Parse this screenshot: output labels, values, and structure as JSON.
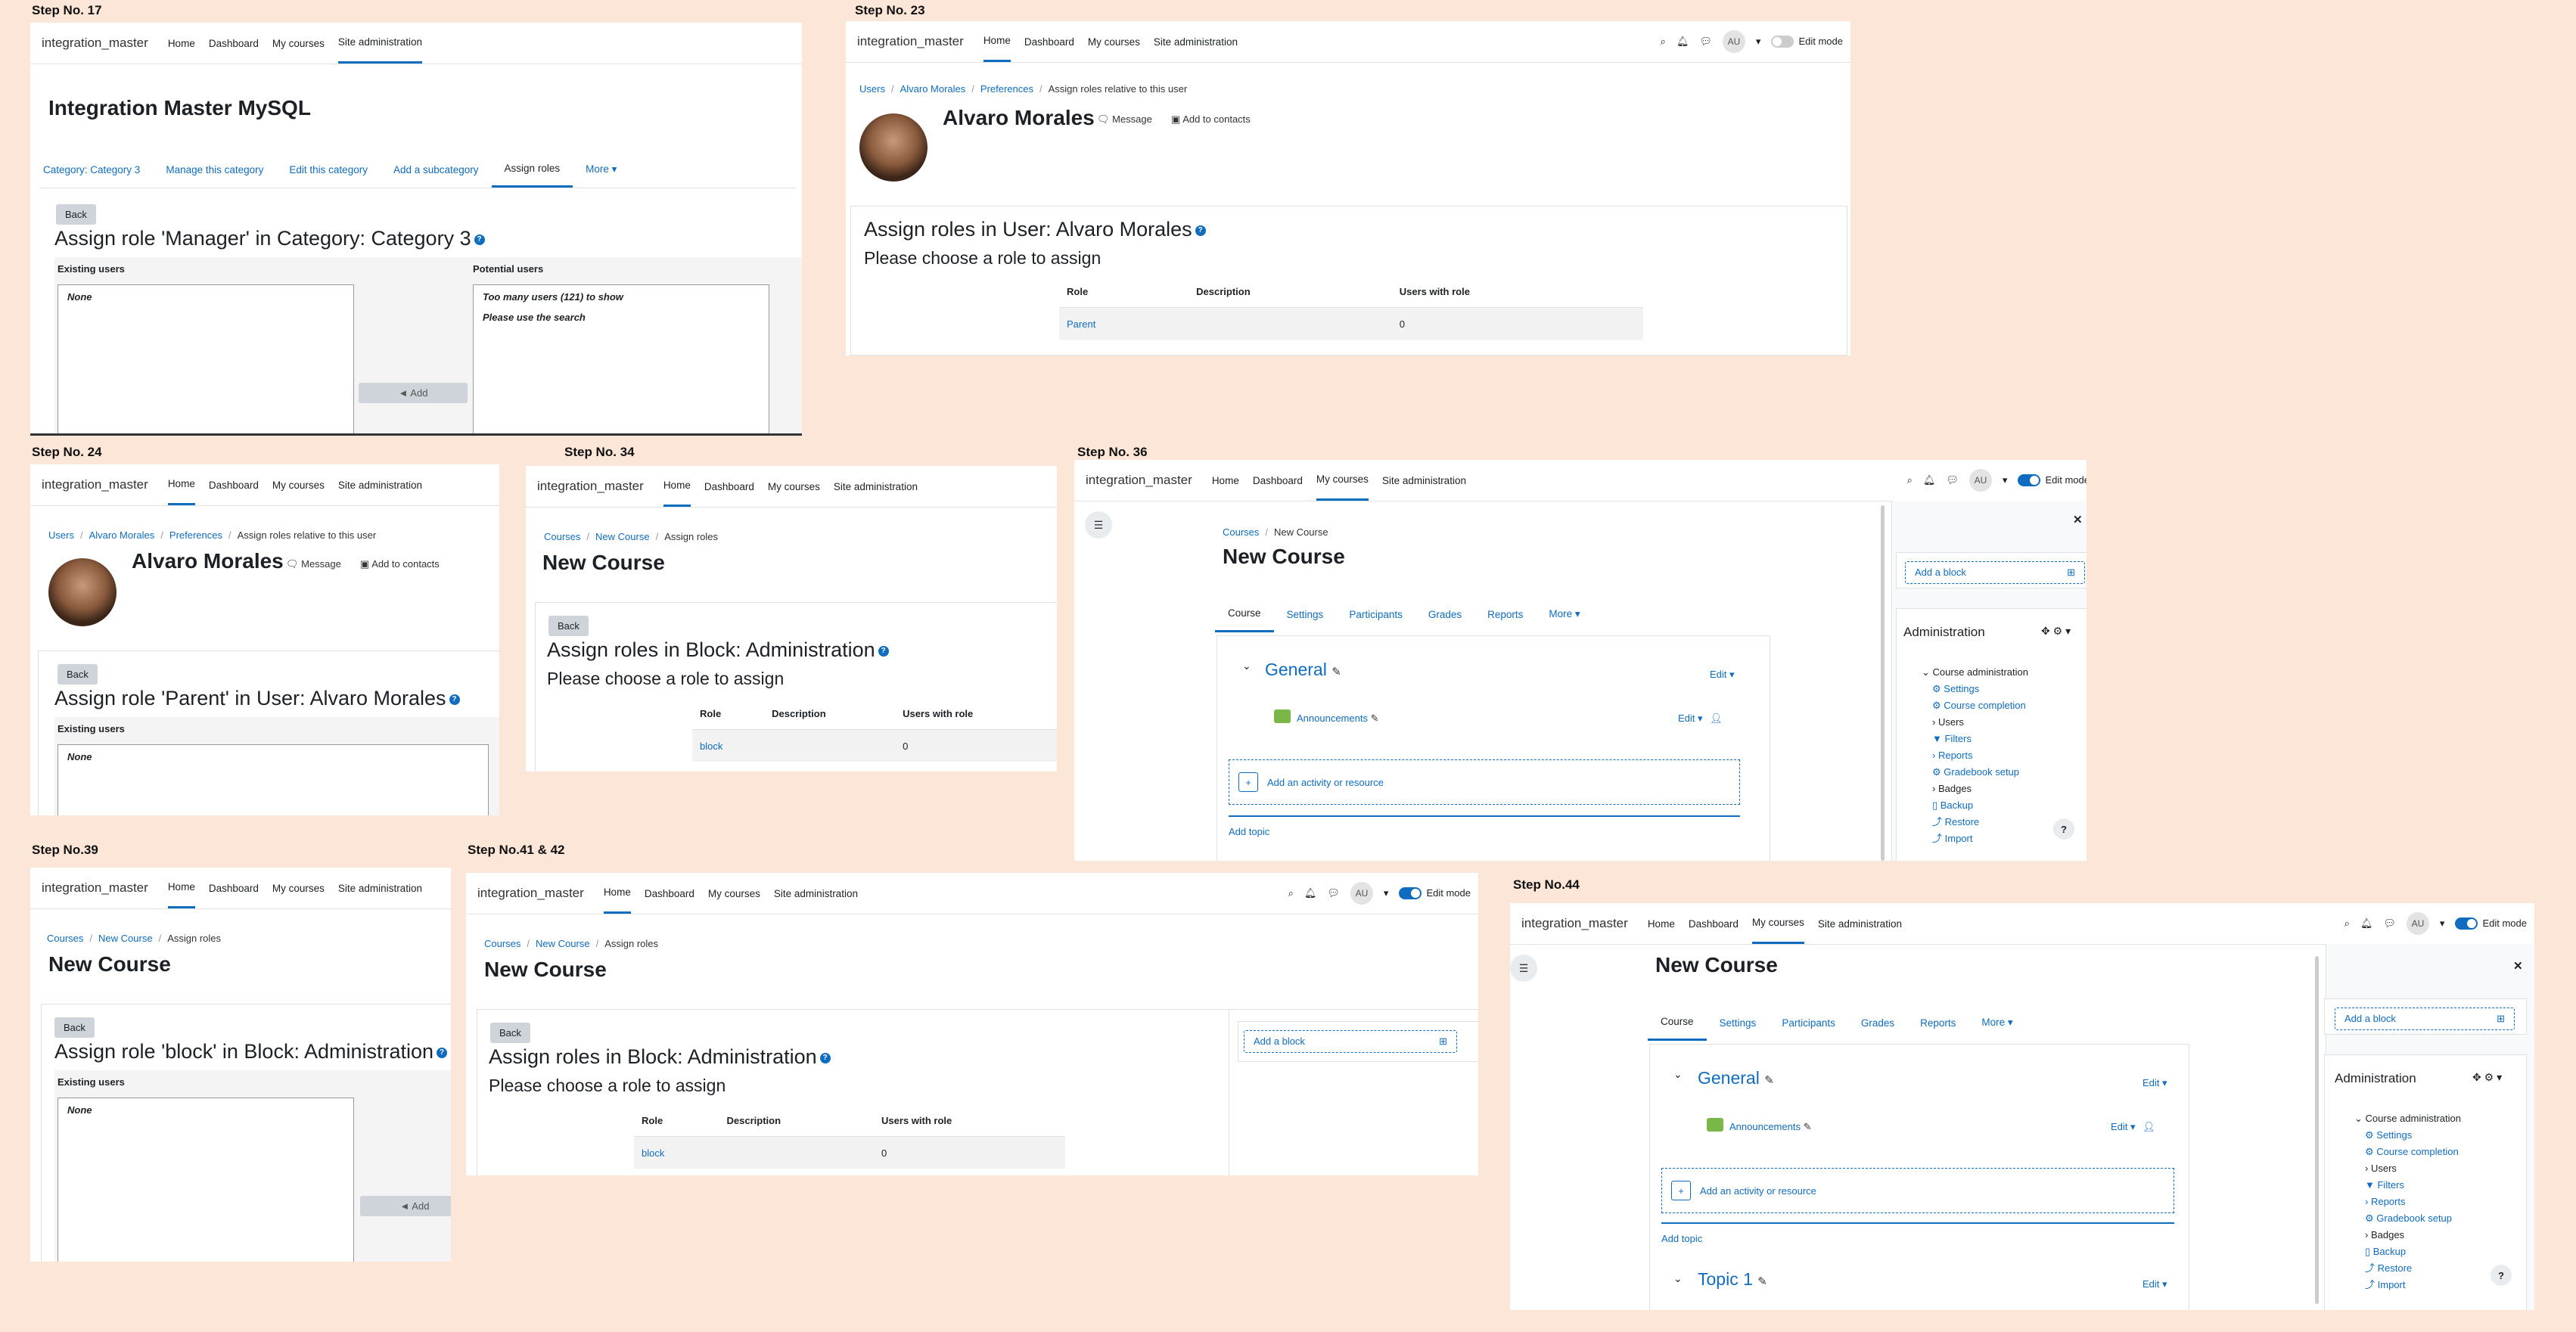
{
  "brand": "integration_master",
  "nav": {
    "home": "Home",
    "dashboard": "Dashboard",
    "mycourses": "My courses",
    "siteadmin": "Site administration"
  },
  "common": {
    "back": "Back",
    "add": "◄ Add",
    "edit_mode": "Edit mode",
    "avatar_initials": "AU",
    "existing_users": "Existing users",
    "potential_users": "Potential users",
    "none": "None",
    "choose_role": "Please choose a role to assign",
    "col_role": "Role",
    "col_desc": "Description",
    "col_users": "Users with role",
    "message": "Message",
    "add_contacts": "Add to contacts",
    "add_block": "Add a block",
    "edit": "Edit",
    "qmark": "?"
  },
  "step17": {
    "label": "Step No. 17",
    "title": "Integration Master MySQL",
    "tabs": [
      "Category: Category 3",
      "Manage this category",
      "Edit this category",
      "Add a subcategory",
      "Assign roles",
      "More ▾"
    ],
    "heading": "Assign role 'Manager' in Category: Category 3",
    "potential": [
      "Too many users (121) to show",
      "Please use the search"
    ]
  },
  "step23": {
    "label": "Step No. 23",
    "crumbs": [
      "Users",
      "Alvaro Morales",
      "Preferences",
      "Assign roles relative to this user"
    ],
    "name": "Alvaro Morales",
    "heading": "Assign roles in User: Alvaro Morales",
    "row": {
      "role": "Parent",
      "desc": "",
      "count": "0"
    }
  },
  "step24": {
    "label": "Step No. 24",
    "crumbs": [
      "Users",
      "Alvaro Morales",
      "Preferences",
      "Assign roles relative to this user"
    ],
    "name": "Alvaro Morales",
    "heading": "Assign role 'Parent' in User: Alvaro Morales"
  },
  "step34": {
    "label": "Step No. 34",
    "crumbs": [
      "Courses",
      "New Course",
      "Assign roles"
    ],
    "title": "New Course",
    "heading": "Assign roles in Block: Administration",
    "row": {
      "role": "block",
      "desc": "",
      "count": "0"
    }
  },
  "step36": {
    "label": "Step No. 36",
    "crumbs": [
      "Courses",
      "New Course"
    ],
    "title": "New Course",
    "tabs": [
      "Course",
      "Settings",
      "Participants",
      "Grades",
      "Reports",
      "More ▾"
    ],
    "section": "General",
    "announcements": "Announcements",
    "add_activity": "Add an activity or resource",
    "add_topic": "Add topic",
    "admin_title": "Administration",
    "admin_tree": [
      "Course administration",
      "Settings",
      "Course completion",
      "Users",
      "Filters",
      "Reports",
      "Gradebook setup",
      "Badges",
      "Backup",
      "Restore",
      "Import"
    ]
  },
  "step39": {
    "label": "Step No.39",
    "crumbs": [
      "Courses",
      "New Course",
      "Assign roles"
    ],
    "title": "New Course",
    "heading": "Assign role 'block' in Block: Administration"
  },
  "step41": {
    "label": "Step No.41 & 42",
    "crumbs": [
      "Courses",
      "New Course",
      "Assign roles"
    ],
    "title": "New Course",
    "heading": "Assign roles in Block: Administration",
    "row": {
      "role": "block",
      "desc": "",
      "count": "0"
    }
  },
  "step44": {
    "label": "Step No.44",
    "title": "New Course",
    "tabs": [
      "Course",
      "Settings",
      "Participants",
      "Grades",
      "Reports",
      "More ▾"
    ],
    "section": "General",
    "announcements": "Announcements",
    "add_activity": "Add an activity or resource",
    "add_topic": "Add topic",
    "topic1": "Topic 1",
    "admin_title": "Administration",
    "admin_tree": [
      "Course administration",
      "Settings",
      "Course completion",
      "Users",
      "Filters",
      "Reports",
      "Gradebook setup",
      "Badges",
      "Backup",
      "Restore",
      "Import"
    ]
  }
}
